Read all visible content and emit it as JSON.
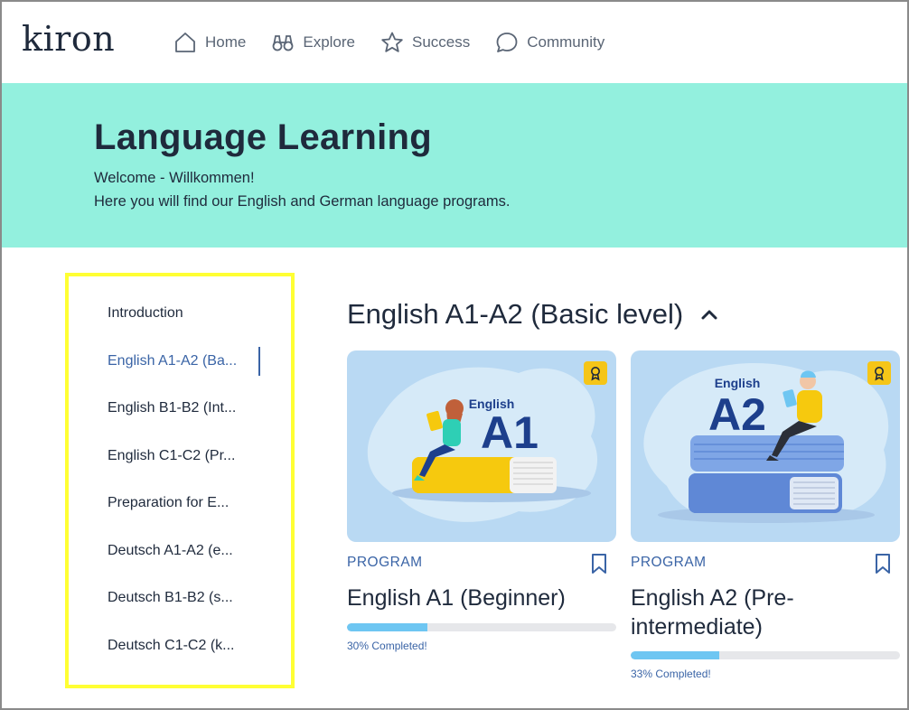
{
  "header": {
    "logo": "kiron",
    "nav": [
      {
        "label": "Home",
        "icon": "home-icon"
      },
      {
        "label": "Explore",
        "icon": "binoculars-icon"
      },
      {
        "label": "Success",
        "icon": "star-icon"
      },
      {
        "label": "Community",
        "icon": "chat-bubble-icon"
      }
    ]
  },
  "hero": {
    "title": "Language Learning",
    "line1": "Welcome - Willkommen!",
    "line2": "Here you will find our English and German language programs."
  },
  "sidebar": {
    "items": [
      {
        "label": "Introduction",
        "active": false
      },
      {
        "label": "English A1-A2 (Ba...",
        "active": true
      },
      {
        "label": "English B1-B2 (Int...",
        "active": false
      },
      {
        "label": "English C1-C2 (Pr...",
        "active": false
      },
      {
        "label": "Preparation for E...",
        "active": false
      },
      {
        "label": "Deutsch A1-A2 (e...",
        "active": false
      },
      {
        "label": "Deutsch B1-B2 (s...",
        "active": false
      },
      {
        "label": "Deutsch C1-C2 (k...",
        "active": false
      }
    ]
  },
  "main": {
    "section_title": "English A1-A2 (Basic level)",
    "cards": [
      {
        "type": "PROGRAM",
        "title": "English A1 (Beginner)",
        "art_word": "English",
        "art_level": "A1",
        "progress": 0.3,
        "progress_text": "30% Completed!"
      },
      {
        "type": "PROGRAM",
        "title": "English A2 (Pre-intermediate)",
        "art_word": "English",
        "art_level": "A2",
        "progress": 0.33,
        "progress_text": "33% Completed!"
      }
    ]
  },
  "colors": {
    "hero_bg": "#93f0de",
    "accent_blue": "#3a64a6",
    "progress_fill": "#6ec6f2",
    "highlight_border": "#ffff33",
    "award_badge": "#f5c518"
  }
}
